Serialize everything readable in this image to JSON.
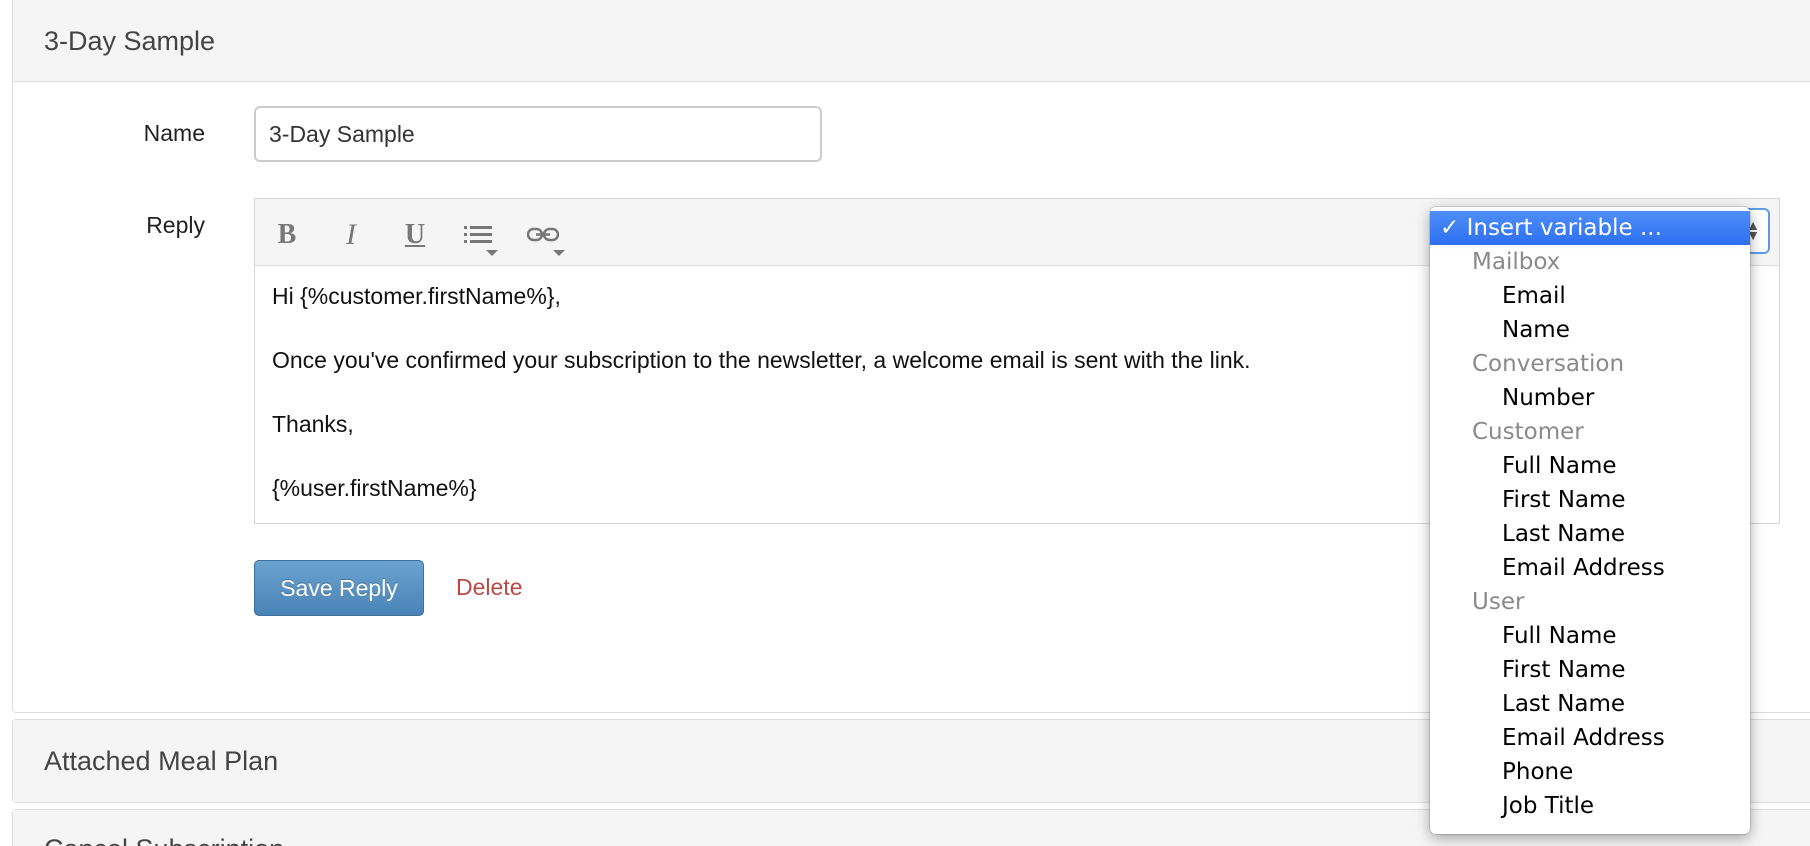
{
  "panels": [
    {
      "title": "3-Day Sample"
    },
    {
      "title": "Attached Meal Plan"
    },
    {
      "title": "Cancel Subscription"
    }
  ],
  "form": {
    "name_label": "Name",
    "name_value": "3-Day Sample",
    "reply_label": "Reply"
  },
  "toolbar": {
    "bold": "B",
    "italic": "I",
    "underline": "U",
    "icons": [
      "list-icon",
      "link-icon"
    ]
  },
  "editor": {
    "lines": [
      "Hi {%customer.firstName%},",
      "Once you've confirmed your subscription to the newsletter, a welcome email is sent with the link.",
      "Thanks,",
      "{%user.firstName%}"
    ]
  },
  "actions": {
    "save_label": "Save Reply",
    "delete_label": "Delete"
  },
  "colors": {
    "save_button": "#5a93c4",
    "delete_link": "#b94a48",
    "menu_highlight": "#3b7ef4"
  },
  "variable_menu": {
    "selected": "✓ Insert variable ...",
    "groups": [
      {
        "label": "Mailbox",
        "items": [
          "Email",
          "Name"
        ]
      },
      {
        "label": "Conversation",
        "items": [
          "Number"
        ]
      },
      {
        "label": "Customer",
        "items": [
          "Full Name",
          "First Name",
          "Last Name",
          "Email Address"
        ]
      },
      {
        "label": "User",
        "items": [
          "Full Name",
          "First Name",
          "Last Name",
          "Email Address",
          "Phone",
          "Job Title"
        ]
      }
    ]
  }
}
